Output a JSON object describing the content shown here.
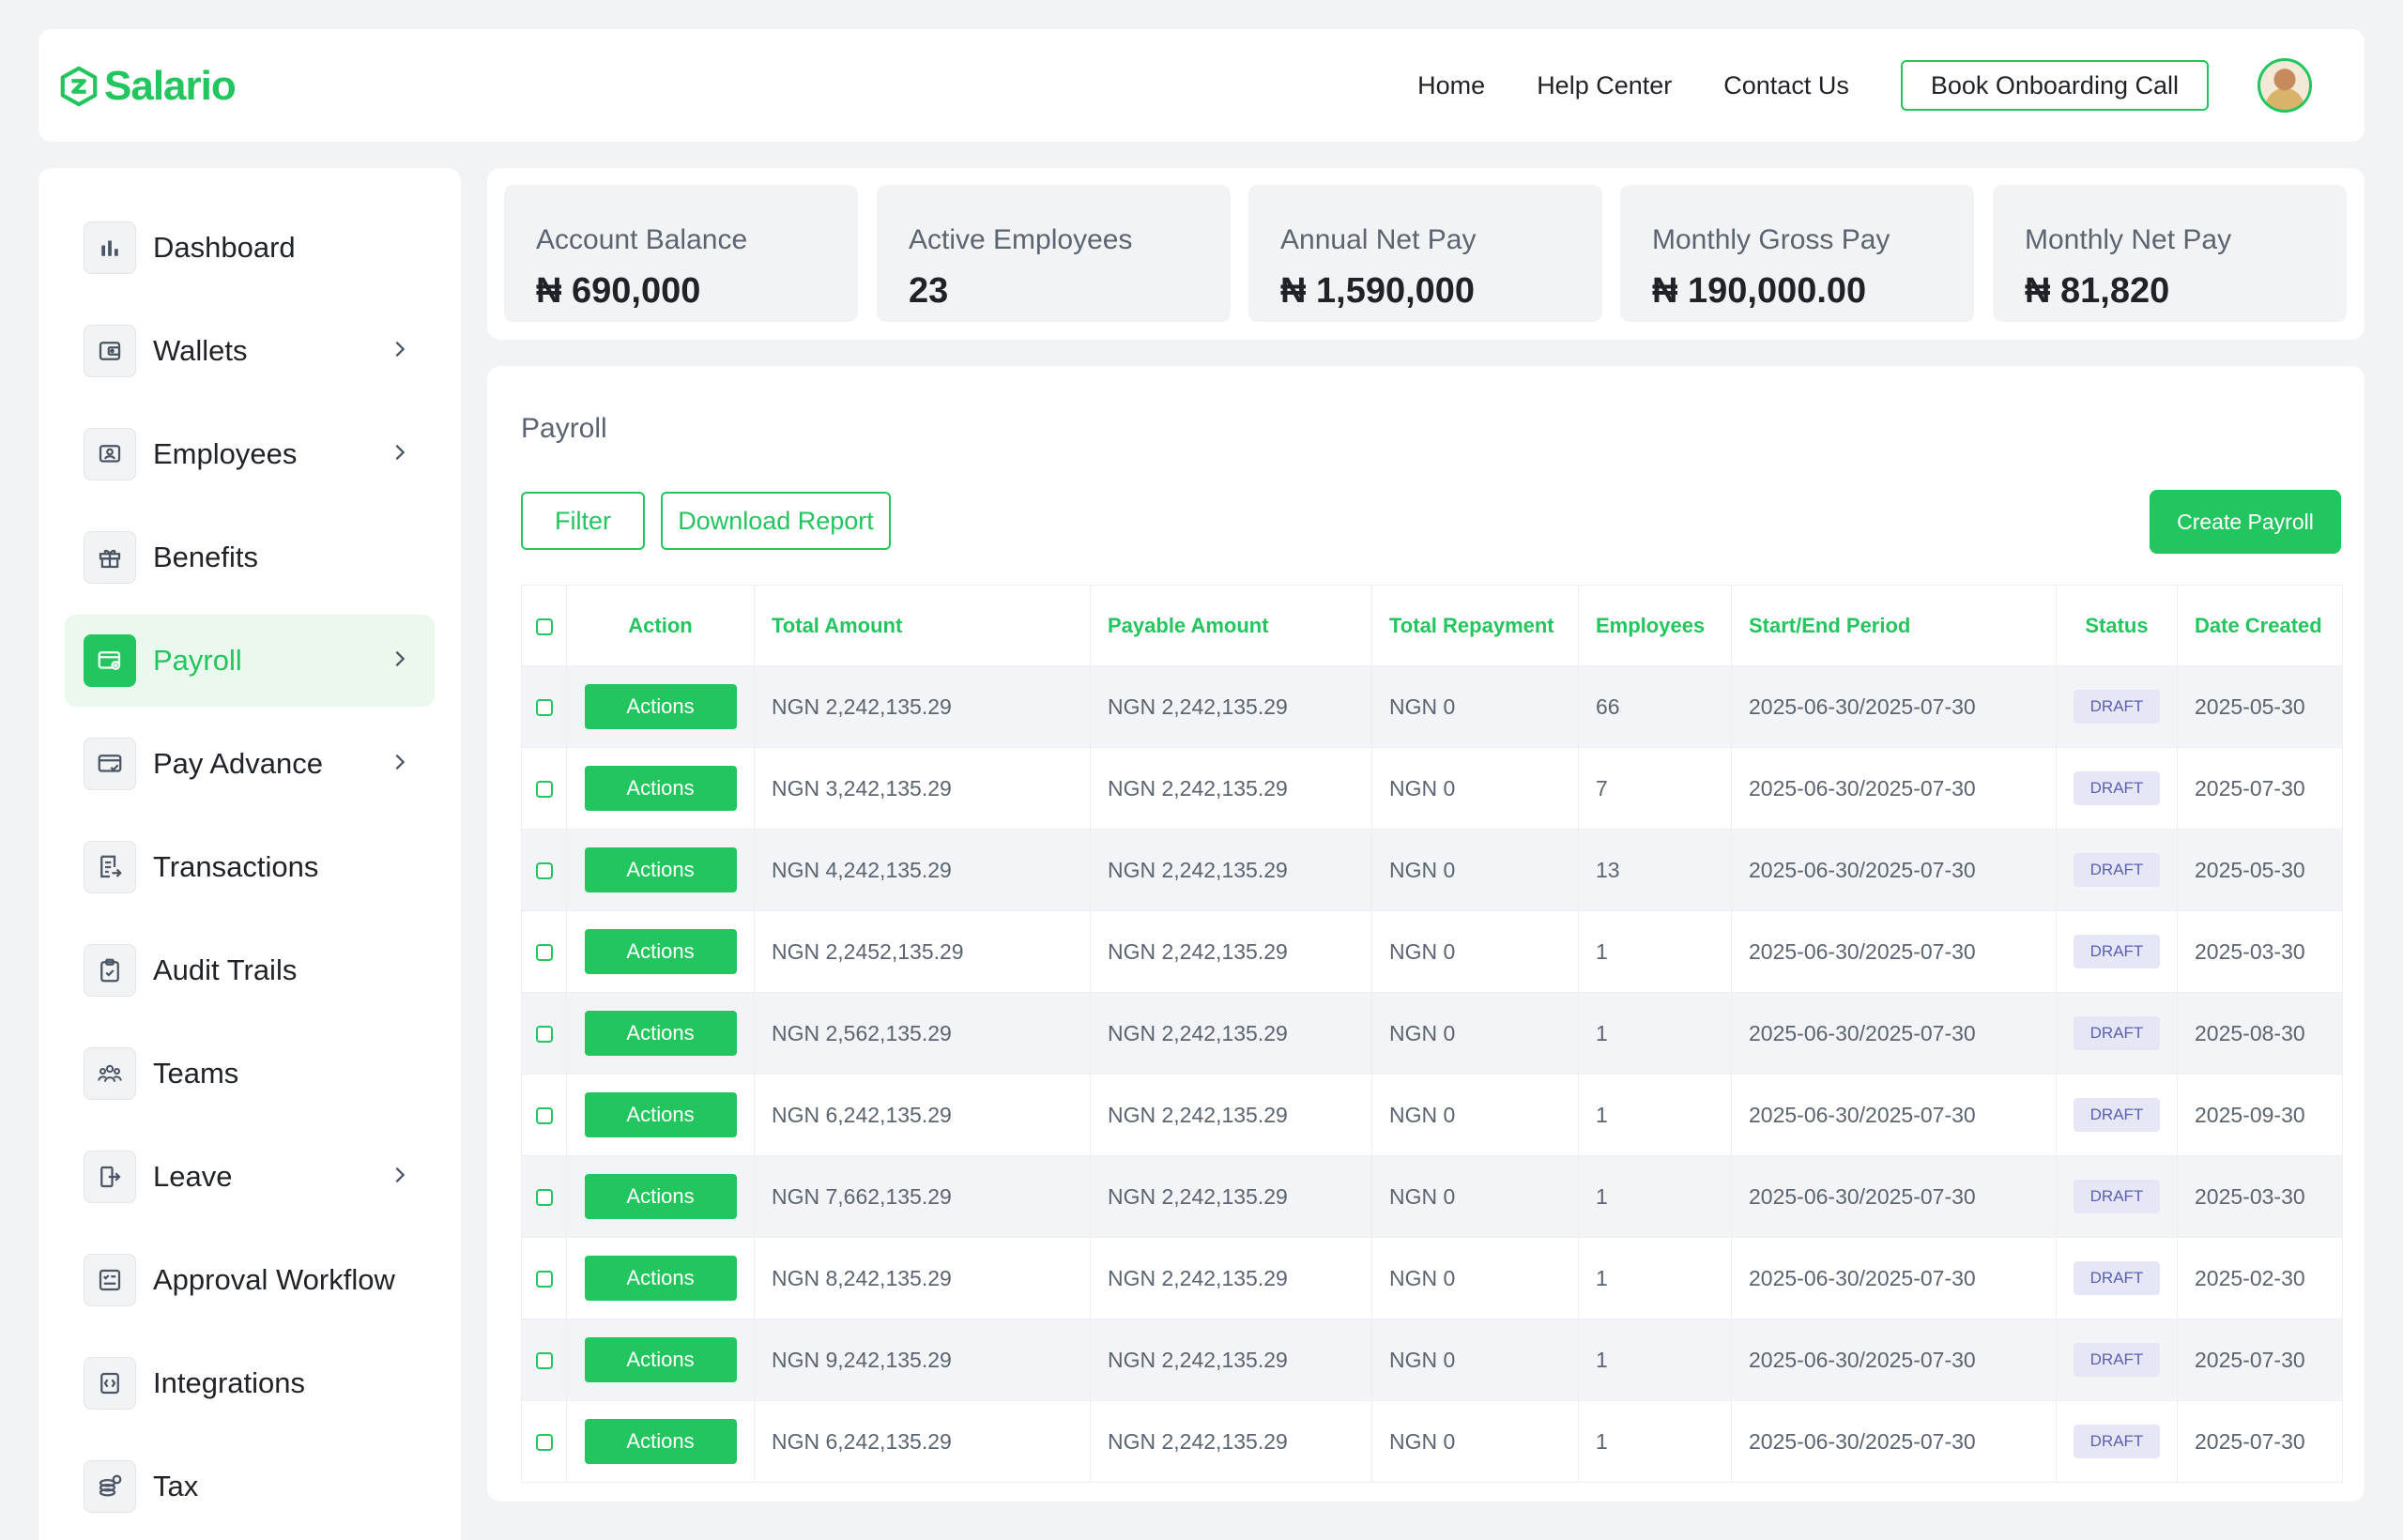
{
  "header": {
    "brand": "Salario",
    "nav": [
      "Home",
      "Help Center",
      "Contact Us"
    ],
    "book_label": "Book Onboarding Call"
  },
  "sidebar": {
    "items": [
      {
        "label": "Dashboard",
        "icon": "bar-chart-icon",
        "chevron": false,
        "active": false
      },
      {
        "label": "Wallets",
        "icon": "wallet-icon",
        "chevron": true,
        "active": false
      },
      {
        "label": "Employees",
        "icon": "id-card-icon",
        "chevron": true,
        "active": false
      },
      {
        "label": "Benefits",
        "icon": "gift-icon",
        "chevron": false,
        "active": false
      },
      {
        "label": "Payroll",
        "icon": "payroll-icon",
        "chevron": true,
        "active": true
      },
      {
        "label": "Pay Advance",
        "icon": "card-check-icon",
        "chevron": true,
        "active": false
      },
      {
        "label": "Transactions",
        "icon": "receipt-icon",
        "chevron": false,
        "active": false
      },
      {
        "label": "Audit Trails",
        "icon": "clipboard-check-icon",
        "chevron": false,
        "active": false
      },
      {
        "label": "Teams",
        "icon": "team-icon",
        "chevron": false,
        "active": false
      },
      {
        "label": "Leave",
        "icon": "leave-icon",
        "chevron": true,
        "active": false
      },
      {
        "label": "Approval Workflow",
        "icon": "checklist-icon",
        "chevron": false,
        "active": false
      },
      {
        "label": "Integrations",
        "icon": "plug-icon",
        "chevron": false,
        "active": false
      },
      {
        "label": "Tax",
        "icon": "coins-icon",
        "chevron": false,
        "active": false
      }
    ]
  },
  "stats": [
    {
      "label": "Account Balance",
      "value": "₦ 690,000"
    },
    {
      "label": "Active Employees",
      "value": "23"
    },
    {
      "label": "Annual Net Pay",
      "value": "₦ 1,590,000"
    },
    {
      "label": "Monthly Gross Pay",
      "value": "₦ 190,000.00"
    },
    {
      "label": "Monthly Net Pay",
      "value": "₦ 81,820"
    }
  ],
  "payroll": {
    "title": "Payroll",
    "filter_label": "Filter",
    "download_label": "Download Report",
    "create_label": "Create Payroll",
    "columns": [
      "Action",
      "Total Amount",
      "Payable Amount",
      "Total Repayment",
      "Employees",
      "Start/End Period",
      "Status",
      "Date Created"
    ],
    "action_label": "Actions",
    "rows": [
      {
        "total": "NGN 2,242,135.29",
        "payable": "NGN 2,242,135.29",
        "repayment": "NGN 0",
        "employees": "66",
        "period": "2025-06-30/2025-07-30",
        "status": "DRAFT",
        "created": "2025-05-30"
      },
      {
        "total": "NGN 3,242,135.29",
        "payable": "NGN 2,242,135.29",
        "repayment": "NGN 0",
        "employees": "7",
        "period": "2025-06-30/2025-07-30",
        "status": "DRAFT",
        "created": "2025-07-30"
      },
      {
        "total": "NGN 4,242,135.29",
        "payable": "NGN 2,242,135.29",
        "repayment": "NGN 0",
        "employees": "13",
        "period": "2025-06-30/2025-07-30",
        "status": "DRAFT",
        "created": "2025-05-30"
      },
      {
        "total": "NGN 2,2452,135.29",
        "payable": "NGN 2,242,135.29",
        "repayment": "NGN 0",
        "employees": "1",
        "period": "2025-06-30/2025-07-30",
        "status": "DRAFT",
        "created": "2025-03-30"
      },
      {
        "total": "NGN 2,562,135.29",
        "payable": "NGN 2,242,135.29",
        "repayment": "NGN 0",
        "employees": "1",
        "period": "2025-06-30/2025-07-30",
        "status": "DRAFT",
        "created": "2025-08-30"
      },
      {
        "total": "NGN 6,242,135.29",
        "payable": "NGN 2,242,135.29",
        "repayment": "NGN 0",
        "employees": "1",
        "period": "2025-06-30/2025-07-30",
        "status": "DRAFT",
        "created": "2025-09-30"
      },
      {
        "total": "NGN 7,662,135.29",
        "payable": "NGN 2,242,135.29",
        "repayment": "NGN 0",
        "employees": "1",
        "period": "2025-06-30/2025-07-30",
        "status": "DRAFT",
        "created": "2025-03-30"
      },
      {
        "total": "NGN 8,242,135.29",
        "payable": "NGN 2,242,135.29",
        "repayment": "NGN 0",
        "employees": "1",
        "period": "2025-06-30/2025-07-30",
        "status": "DRAFT",
        "created": "2025-02-30"
      },
      {
        "total": "NGN 9,242,135.29",
        "payable": "NGN 2,242,135.29",
        "repayment": "NGN 0",
        "employees": "1",
        "period": "2025-06-30/2025-07-30",
        "status": "DRAFT",
        "created": "2025-07-30"
      },
      {
        "total": "NGN 6,242,135.29",
        "payable": "NGN 2,242,135.29",
        "repayment": "NGN 0",
        "employees": "1",
        "period": "2025-06-30/2025-07-30",
        "status": "DRAFT",
        "created": "2025-07-30"
      }
    ]
  },
  "colors": {
    "accent": "#22c55e",
    "badge_bg": "#e6e7f6",
    "badge_text": "#5b5fb0"
  }
}
